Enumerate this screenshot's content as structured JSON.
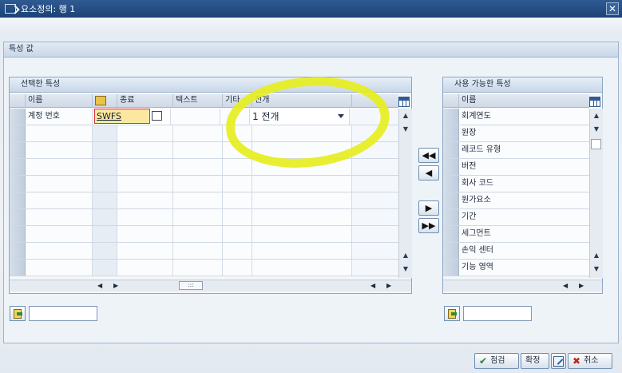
{
  "window": {
    "title": "요소정의: 행 1"
  },
  "group": {
    "title": "특성 값"
  },
  "selected": {
    "title": "선택한 특성",
    "columns": [
      "이름",
      "",
      "종료",
      "텍스트",
      "기타",
      "전개"
    ],
    "row": {
      "name": "계정 번호",
      "end_value": "SWFS",
      "expand": "1 전개"
    }
  },
  "available": {
    "title": "사용 가능한 특성",
    "column": "이름",
    "items": [
      "회계연도",
      "원장",
      "레코드 유형",
      "버전",
      "회사 코드",
      "원가요소",
      "기간",
      "세그먼트",
      "손익 센터",
      "기능 영역"
    ]
  },
  "footer": {
    "check": "점검",
    "confirm": "확정",
    "cancel": "취소"
  },
  "colors": {
    "highlight": "#e6ee1f",
    "titlebar": "#1b4277"
  },
  "icons": [
    "window-icon",
    "close-icon",
    "settings-icon",
    "find-icon",
    "check-icon",
    "edit-icon",
    "cancel-icon"
  ]
}
